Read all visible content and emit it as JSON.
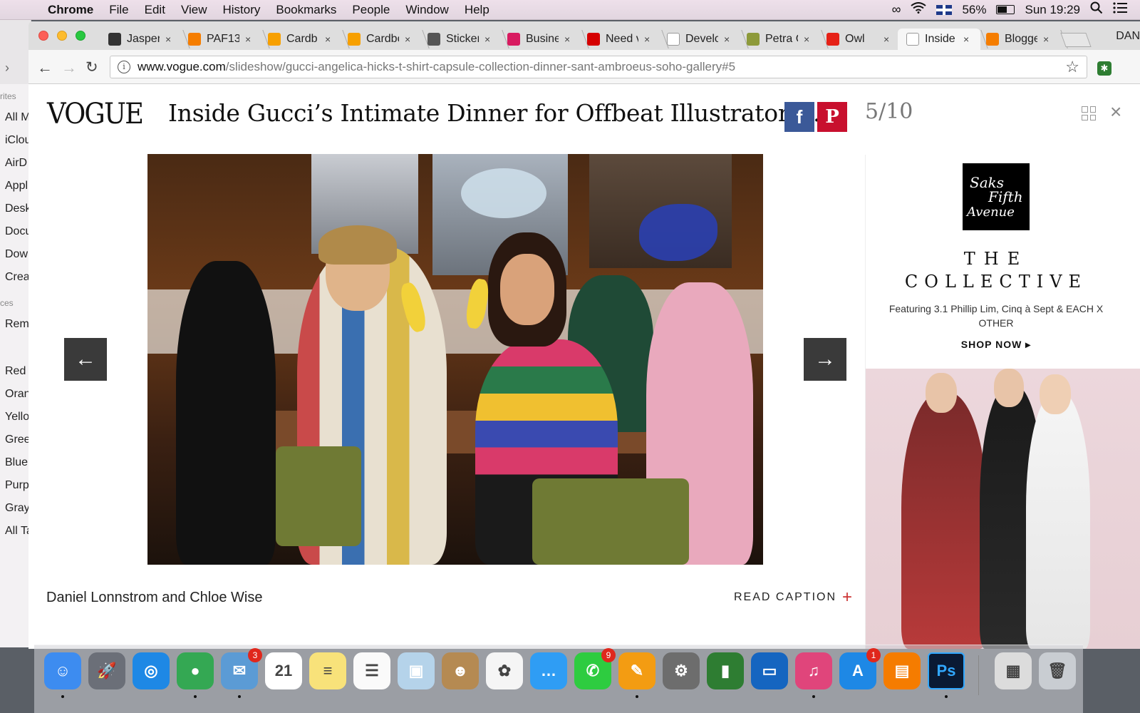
{
  "menubar": {
    "app": "Chrome",
    "items": [
      "File",
      "Edit",
      "View",
      "History",
      "Bookmarks",
      "People",
      "Window",
      "Help"
    ],
    "battery": "56%",
    "clock": "Sun 19:29",
    "battery_level": 0.56
  },
  "finder_sidebar": {
    "section1": "rites",
    "items1": [
      "All M",
      "iClou",
      "AirD",
      "Appl",
      "Desk",
      "Docu",
      "Dow",
      "Crea"
    ],
    "section2": "ces",
    "items2": [
      "Rem"
    ],
    "tags": [
      "Red",
      "Oran",
      "Yello",
      "Gree",
      "Blue",
      "Purp",
      "Gray",
      "All Ta"
    ]
  },
  "tabs": [
    {
      "title": "Jasper",
      "icon": "squarespace-icon",
      "color": "#333333"
    },
    {
      "title": "PAF13",
      "icon": "blogger-icon",
      "color": "#f57d00"
    },
    {
      "title": "Cardb",
      "icon": "illustrator-icon",
      "color": "#f7a000"
    },
    {
      "title": "Cardbo",
      "icon": "illustrator-icon",
      "color": "#f7a000"
    },
    {
      "title": "Sticker",
      "icon": "box-icon",
      "color": "#555555"
    },
    {
      "title": "Busine",
      "icon": "colorblock-icon",
      "color": "#d81b60"
    },
    {
      "title": "Need v",
      "icon": "redflag-icon",
      "color": "#d50000"
    },
    {
      "title": "Develo",
      "icon": "document-icon",
      "color": "#ffffff"
    },
    {
      "title": "Petra C",
      "icon": "avatar-icon",
      "color": "#8d9a3a"
    },
    {
      "title": "Owl",
      "icon": "youtube-icon",
      "color": "#e62117"
    },
    {
      "title": "Inside",
      "icon": "vogue-v-icon",
      "color": "#ffffff"
    },
    {
      "title": "Blogge",
      "icon": "blogger-icon",
      "color": "#f57d00"
    }
  ],
  "profile_name": "DAN",
  "url": {
    "host": "www.vogue.com",
    "path": "/slideshow/gucci-angelica-hicks-t-shirt-capsule-collection-dinner-sant-ambroeus-soho-gallery#5"
  },
  "page": {
    "logo": "VOGUE",
    "title": "Inside Gucci’s Intimate Dinner for Offbeat Illustrator A...",
    "facebook_label": "f",
    "pinterest_label": "P",
    "counter": "5/10",
    "caption": "Daniel Lonnstrom and Chloe Wise",
    "read_caption": "READ CAPTION",
    "prev_arrow": "←",
    "next_arrow": "→"
  },
  "ad": {
    "brand": "Saks Fifth Avenue",
    "line1": "THE",
    "line2": "COLLECTIVE",
    "featuring": "Featuring 3.1 Phillip Lim, Cinq à Sept & EACH X OTHER",
    "cta": "SHOP NOW ▸"
  },
  "dock": [
    {
      "name": "finder",
      "color": "#3d8cf0",
      "glyph": "☺",
      "running": true
    },
    {
      "name": "launchpad",
      "color": "#6b6f78",
      "glyph": "🚀",
      "running": false
    },
    {
      "name": "safari",
      "color": "#1e88e5",
      "glyph": "◎",
      "running": false
    },
    {
      "name": "chrome",
      "color": "#34a853",
      "glyph": "●",
      "running": true
    },
    {
      "name": "mail",
      "color": "#5b9bd5",
      "glyph": "✉",
      "badge": "3",
      "running": true
    },
    {
      "name": "calendar",
      "color": "#ffffff",
      "glyph": "21",
      "running": false
    },
    {
      "name": "notes",
      "color": "#f8e27a",
      "glyph": "≡",
      "running": false
    },
    {
      "name": "reminders",
      "color": "#fafafa",
      "glyph": "☰",
      "running": false
    },
    {
      "name": "preview",
      "color": "#b5d3ea",
      "glyph": "▣",
      "running": false
    },
    {
      "name": "contacts",
      "color": "#b58a52",
      "glyph": "☻",
      "running": false
    },
    {
      "name": "photos",
      "color": "#f5f5f5",
      "glyph": "✿",
      "running": false
    },
    {
      "name": "messages",
      "color": "#2f9df4",
      "glyph": "…",
      "running": false
    },
    {
      "name": "facetime",
      "color": "#2ecc40",
      "glyph": "✆",
      "badge": "9",
      "running": false
    },
    {
      "name": "pages",
      "color": "#f39c12",
      "glyph": "✎",
      "running": true
    },
    {
      "name": "system-preferences",
      "color": "#6d6d6d",
      "glyph": "⚙",
      "running": false
    },
    {
      "name": "numbers",
      "color": "#2e7d32",
      "glyph": "▮",
      "running": false
    },
    {
      "name": "keynote",
      "color": "#1565c0",
      "glyph": "▭",
      "running": false
    },
    {
      "name": "itunes",
      "color": "#e0457b",
      "glyph": "♫",
      "running": true
    },
    {
      "name": "app-store",
      "color": "#1e88e5",
      "glyph": "A",
      "badge": "1",
      "running": false
    },
    {
      "name": "ibooks",
      "color": "#f57c00",
      "glyph": "▤",
      "running": false
    },
    {
      "name": "photoshop",
      "color": "#0a1a33",
      "glyph": "Ps",
      "running": true
    },
    {
      "name": "chrome-window",
      "color": "#dcdcdc",
      "glyph": "▦",
      "running": false
    },
    {
      "name": "trash",
      "color": "#c9cdd2",
      "glyph": "🗑",
      "running": false
    }
  ]
}
